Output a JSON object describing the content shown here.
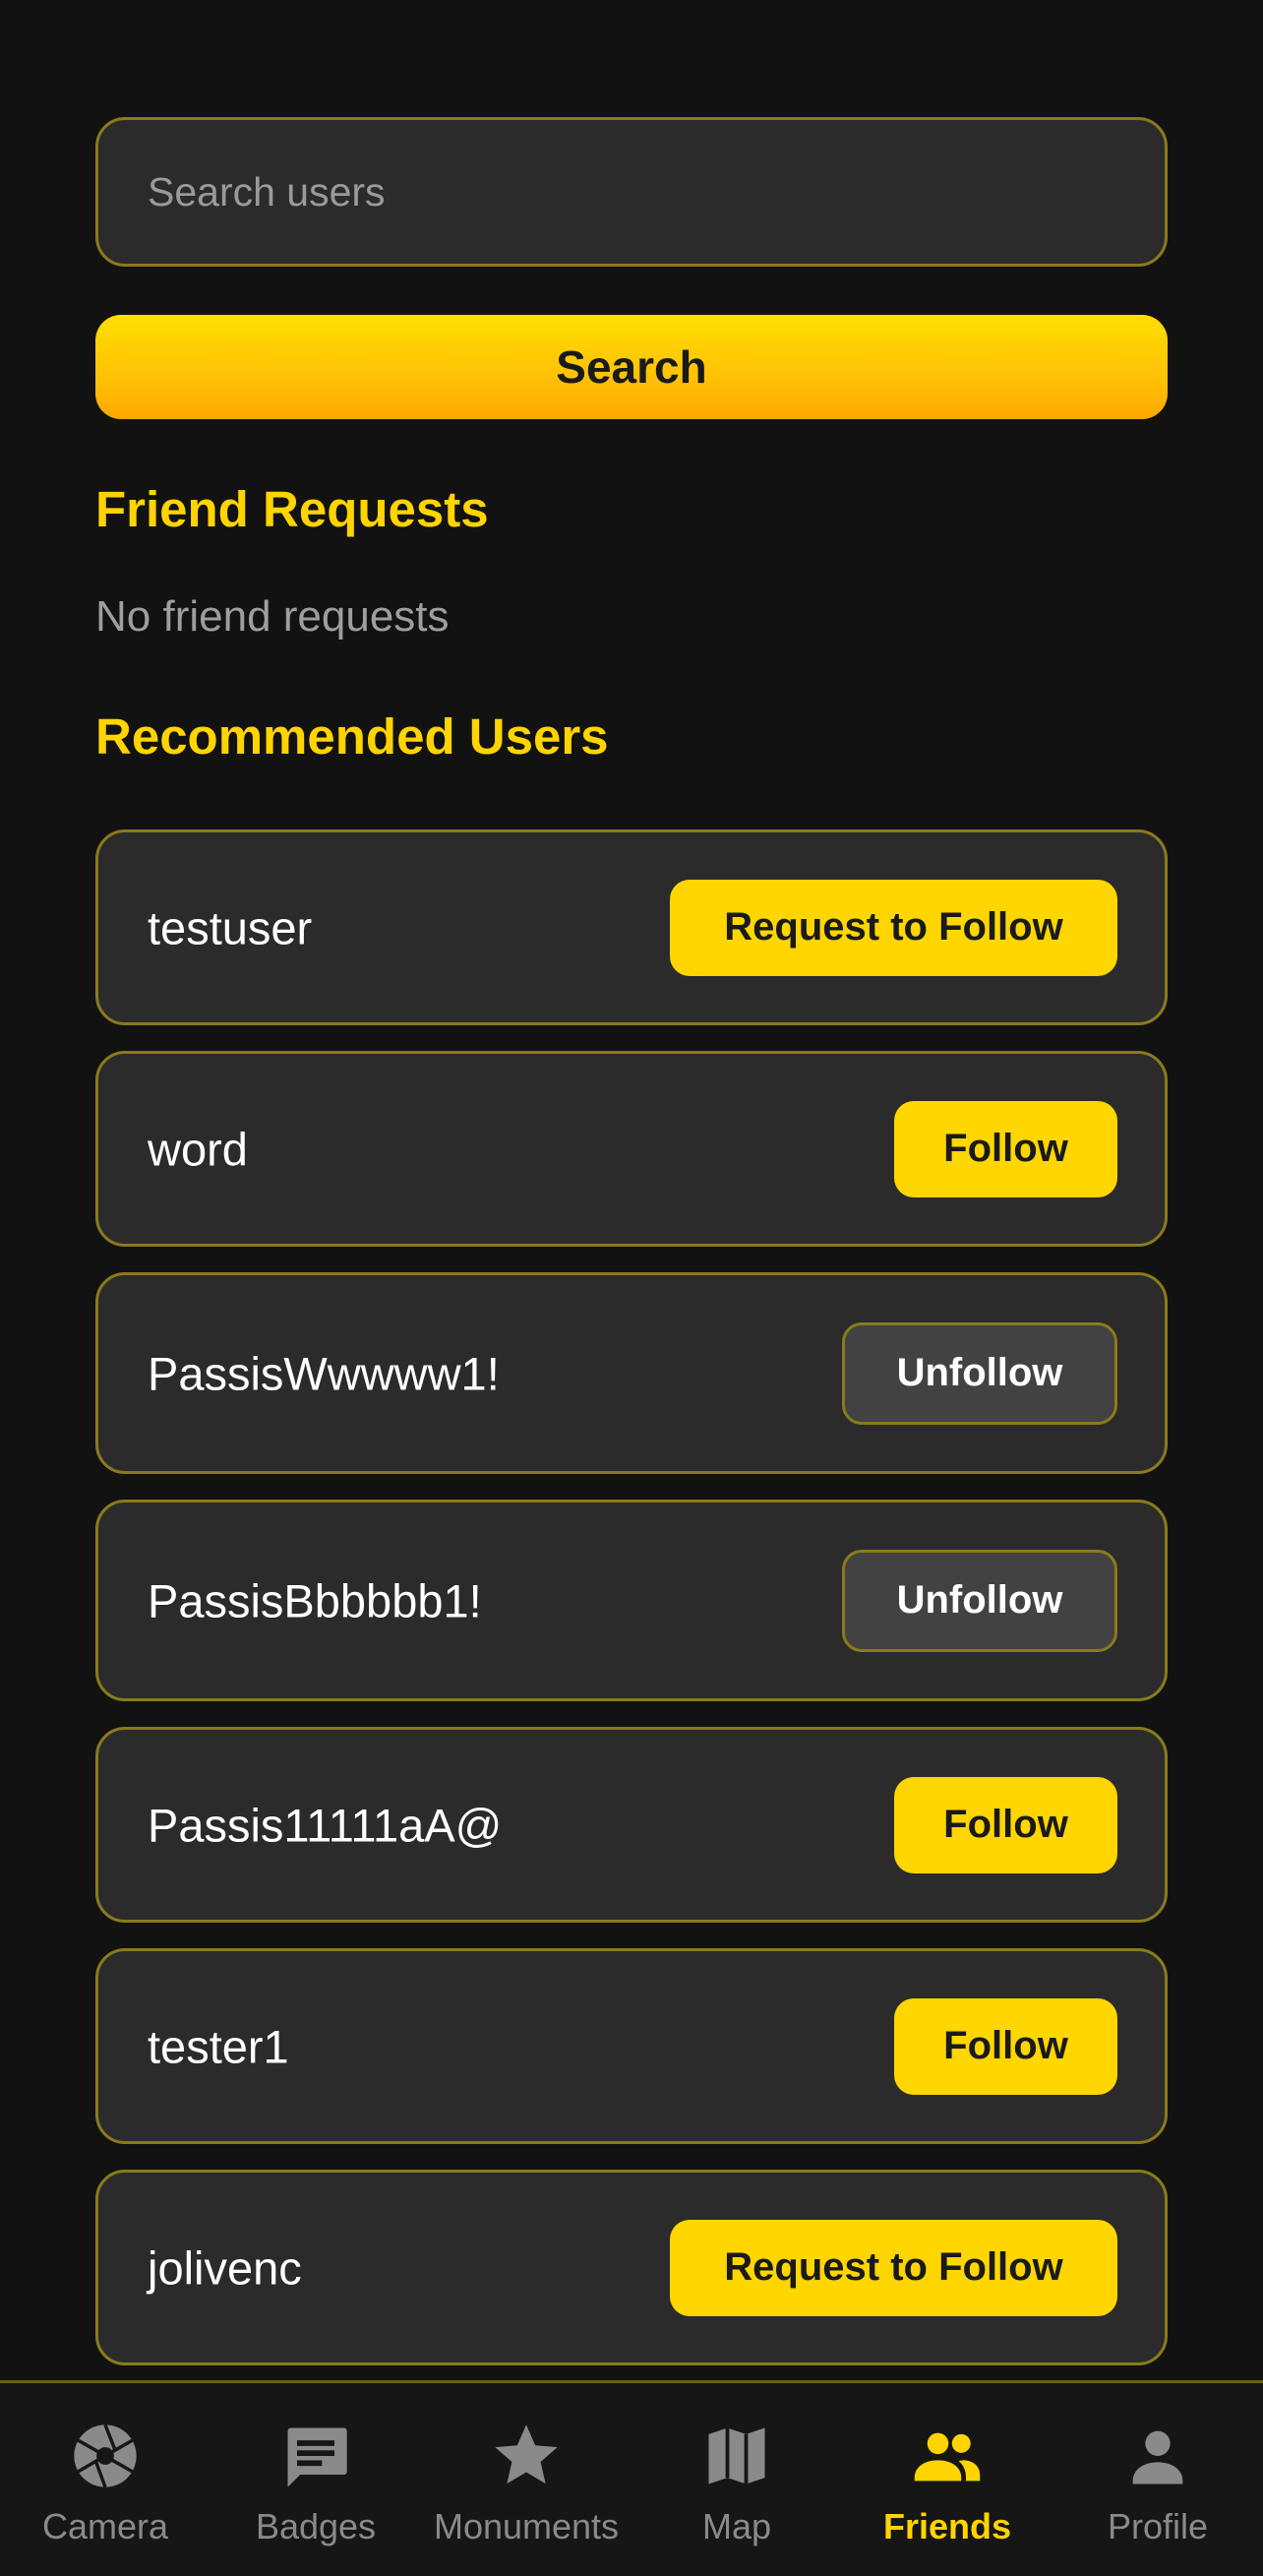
{
  "search": {
    "placeholder": "Search users",
    "value": "",
    "button_label": "Search"
  },
  "friend_requests": {
    "title": "Friend Requests",
    "empty_text": "No friend requests"
  },
  "recommended": {
    "title": "Recommended Users",
    "users": [
      {
        "name": "testuser",
        "action": "Request to Follow",
        "state": "request"
      },
      {
        "name": "word",
        "action": "Follow",
        "state": "follow"
      },
      {
        "name": "PassisWwwww1!",
        "action": "Unfollow",
        "state": "unfollow"
      },
      {
        "name": "PassisBbbbbb1!",
        "action": "Unfollow",
        "state": "unfollow"
      },
      {
        "name": "Passis11111aA@",
        "action": "Follow",
        "state": "follow"
      },
      {
        "name": "tester1",
        "action": "Follow",
        "state": "follow"
      },
      {
        "name": "jolivenc",
        "action": "Request to Follow",
        "state": "request"
      }
    ]
  },
  "tabs": [
    {
      "label": "Camera",
      "icon": "camera-shutter-icon",
      "active": false
    },
    {
      "label": "Badges",
      "icon": "message-badge-icon",
      "active": false
    },
    {
      "label": "Monuments",
      "icon": "star-icon",
      "active": false
    },
    {
      "label": "Map",
      "icon": "map-icon",
      "active": false
    },
    {
      "label": "Friends",
      "icon": "people-icon",
      "active": true
    },
    {
      "label": "Profile",
      "icon": "person-icon",
      "active": false
    }
  ],
  "colors": {
    "accent": "#ffd400",
    "background": "#121212",
    "card": "#2b2b2b",
    "card_border": "#8a7a1c",
    "inactive": "#8a8a8a"
  }
}
